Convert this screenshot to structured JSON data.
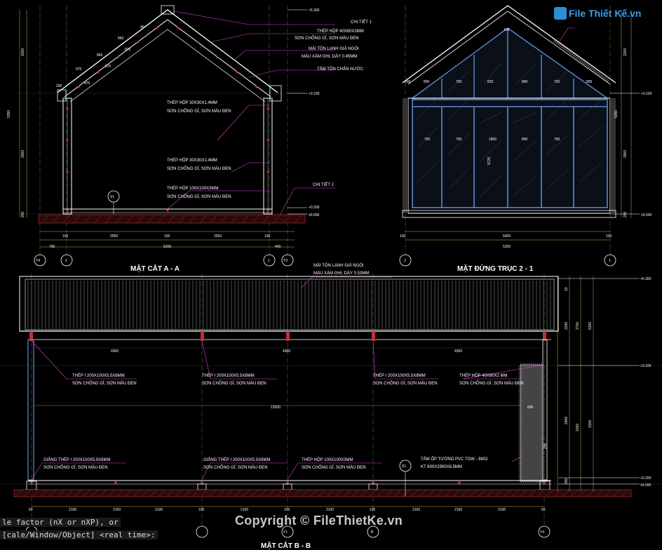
{
  "section_a": {
    "title": "MẶT CẮT A - A",
    "callouts": [
      "CHI TIẾT 1",
      "THÉP HỘP 40X80X2MM",
      "SƠN CHỐNG GỈ, SƠN MÀU ĐEN",
      "MÁI TÔN LẠNH GIẢ NGÓI",
      "MÀU XÁM GHI, DÀY 0.45MM",
      "TẤM TÔN CHẮN NƯỚC",
      "THÉP HỘP 30X30X1.4MM",
      "SƠN CHỐNG GỈ, SƠN MÀU ĐEN",
      "THÉP HỘP 30X30X1.4MM",
      "SƠN CHỐNG GỈ, SƠN MÀU ĐEN",
      "THÉP HỘP 100X100X3MM",
      "SƠN CHỐNG GỈ, SƠN MÀU ĐEN",
      "CHI TIẾT 2"
    ],
    "levels": [
      "+5.300",
      "+3.100",
      "+0.200",
      "±0.000"
    ],
    "dims_bottom": [
      "100",
      "2550",
      "100",
      "2550",
      "100",
      "700",
      "5200",
      "440"
    ],
    "dims_left": [
      "5350",
      "2200",
      "2900",
      "250"
    ],
    "axes": [
      "Y4",
      "2",
      "1",
      "Y3"
    ],
    "section_mark": "S1",
    "roof_dims": [
      "40",
      "80",
      "40",
      "860",
      "40",
      "970",
      "870",
      "40",
      "870",
      "870",
      "200",
      "40"
    ]
  },
  "elevation": {
    "title": "MẶT ĐỨNG TRỤC 2 - 1",
    "dims_bottom": [
      "100",
      "5000",
      "100",
      "5200"
    ],
    "dims_right": [
      "2200",
      "2900",
      "5350",
      "250"
    ],
    "levels": [
      "+3.100",
      "±0.000"
    ],
    "axes": [
      "2",
      "1"
    ],
    "panel_dims": [
      "200",
      "800",
      "750",
      "825",
      "50",
      "800",
      "50",
      "825",
      "750",
      "800",
      "200",
      "750",
      "750",
      "800",
      "800",
      "750",
      "750",
      "104"
    ],
    "door_dims": [
      "1800",
      "9720"
    ]
  },
  "section_b": {
    "title": "MẶT CẮT B - B",
    "callouts": [
      "MÁI TÔN LẠNH GIẢ NGÓI",
      "MÀU XÁM GHI, DÀY 0.53MM",
      "THÉP I 200X100X5.5X8MM",
      "SƠN CHỐNG GỈ, SƠN MÀU ĐEN",
      "THÉP I 200X100X5.5X8MM",
      "SƠN CHỐNG GỈ, SƠN MÀU ĐEN",
      "THÉP I 200X100X5.5X8MM",
      "SƠN CHỐNG GỈ, SƠN MÀU ĐEN",
      "THÉP HỘP 40X80X2 MM",
      "SƠN CHỐNG GỈ, SƠN MÀU ĐEN",
      "GIẰNG THÉP I 200X100X5.5X8MM",
      "SƠN CHỐNG GỈ, SƠN MÀU ĐEN",
      "GIẰNG THÉP I 200X100X5.5X8MM",
      "SƠN CHỐNG GỈ, SƠN MÀU ĐEN",
      "THÉP HỘP 100X100X3MM",
      "SƠN CHỐNG GỈ, SƠN MÀU ĐEN",
      "TẤM ỐP TƯỜNG PVC TGW - 8602",
      "KT 600X2900X8.5MM"
    ],
    "spans": [
      "4300",
      "4300",
      "4300",
      "12500"
    ],
    "dims_bottom": [
      "50",
      "2100",
      "100",
      "2100",
      "100",
      "2100",
      "100",
      "2100",
      "100",
      "2100",
      "100",
      "2100",
      "50"
    ],
    "dims_right": [
      "10",
      "2200",
      "2700",
      "2900",
      "3150",
      "5300",
      "3100",
      "600",
      "250",
      "200"
    ],
    "levels": [
      "+5.300",
      "+3.100",
      "+0.200",
      "±0.000"
    ],
    "axes": [
      "A",
      "Y1",
      "B",
      "Y4"
    ],
    "section_mark": "S1",
    "panel_label": "600"
  },
  "command_line": [
    "le factor (nX or nXP), or",
    "[cale/Window/Object] <real time>:"
  ],
  "copyright": "Copyright © FileThietKe.vn",
  "logo": "File Thiết Kế.vn",
  "colors": {
    "line": "#ffffff",
    "callout": "#e040e0",
    "dim": "#e8e870",
    "column": "#5a8ad8",
    "hatch": "#c04040",
    "axis_line": "#3a7a3a"
  }
}
